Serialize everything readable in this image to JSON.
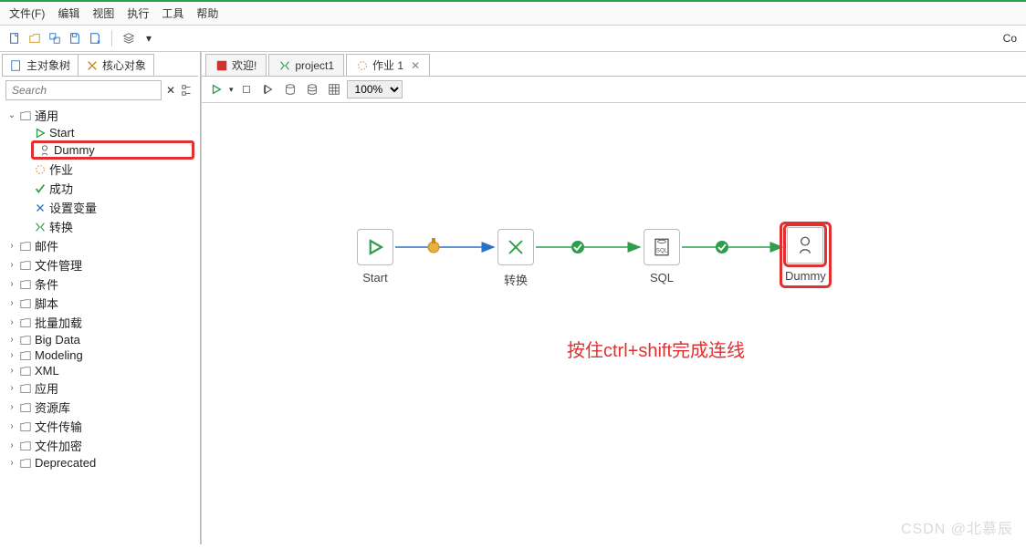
{
  "menubar": {
    "file": "文件(F)",
    "edit": "编辑",
    "view": "视图",
    "run": "执行",
    "tools": "工具",
    "help": "帮助"
  },
  "toolbar_right_label": "Co",
  "sidebar": {
    "tabs": {
      "main_tree": "主对象树",
      "core_objects": "核心对象"
    },
    "search_placeholder": "Search",
    "tree": {
      "general": {
        "label": "通用",
        "children": {
          "start": "Start",
          "dummy": "Dummy",
          "job": "作业",
          "success": "成功",
          "set_variable": "设置变量",
          "transform": "转换"
        }
      },
      "categories": [
        "邮件",
        "文件管理",
        "条件",
        "脚本",
        "批量加载",
        "Big Data",
        "Modeling",
        "XML",
        "应用",
        "资源库",
        "文件传输",
        "文件加密",
        "Deprecated"
      ]
    }
  },
  "doc_tabs": {
    "welcome": "欢迎!",
    "project1": "project1",
    "job1": "作业 1"
  },
  "canvas_toolbar": {
    "zoom": "100%"
  },
  "flow_nodes": {
    "start": "Start",
    "transform": "转换",
    "sql": "SQL",
    "dummy": "Dummy"
  },
  "annotation": "按住ctrl+shift完成连线",
  "watermark": "CSDN @北慕辰"
}
